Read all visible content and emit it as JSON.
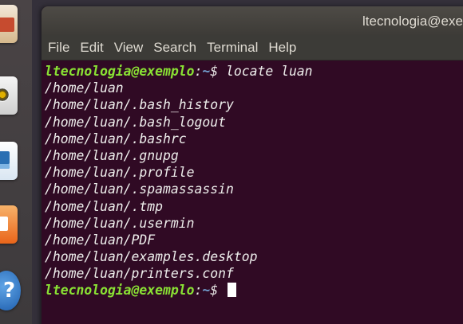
{
  "window": {
    "title": "ltecnologia@exemplo: ~"
  },
  "menu": [
    "File",
    "Edit",
    "View",
    "Search",
    "Terminal",
    "Help"
  ],
  "prompt": {
    "user_host": "ltecnologia@exemplo",
    "separator": ":",
    "dir": "~",
    "symbol": "$ "
  },
  "command": "locate luan",
  "output": [
    "/home/luan",
    "/home/luan/.bash_history",
    "/home/luan/.bash_logout",
    "/home/luan/.bashrc",
    "/home/luan/.gnupg",
    "/home/luan/.profile",
    "/home/luan/.spamassassin",
    "/home/luan/.tmp",
    "/home/luan/.usermin",
    "/home/luan/PDF",
    "/home/luan/examples.desktop",
    "/home/luan/printers.conf"
  ],
  "launcher": {
    "icons": [
      "files-icon",
      "sound-icon",
      "writer-icon",
      "impress-icon",
      "help-icon"
    ],
    "help_glyph": "?"
  },
  "colors": {
    "terminal_bg": "#300a24",
    "prompt_user": "#8ae234",
    "prompt_path": "#729fcf",
    "text": "#eeeeec"
  }
}
